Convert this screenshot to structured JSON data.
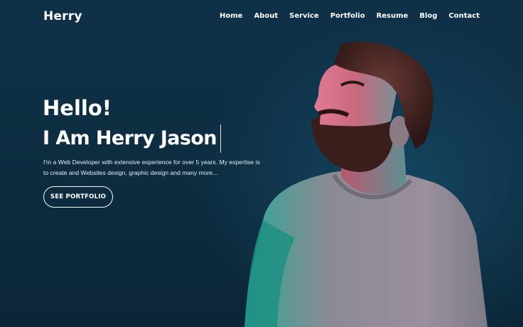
{
  "brand": {
    "logo_text": "Herry"
  },
  "nav": {
    "items": [
      {
        "label": "Home"
      },
      {
        "label": "About"
      },
      {
        "label": "Service"
      },
      {
        "label": "Portfolio"
      },
      {
        "label": "Resume"
      },
      {
        "label": "Blog"
      },
      {
        "label": "Contact"
      }
    ]
  },
  "hero": {
    "greeting": "Hello!",
    "name_line": "I Am Herry Jason",
    "description": "I'm a Web Developer with extensive experience for over 5 years. My expertise is to create and Websites design, graphic design and many more...",
    "cta_label": "SEE PORTFOLIO",
    "image_subject": "bearded-man-portrait"
  },
  "colors": {
    "background": "#0e2f44",
    "text": "#ffffff",
    "shirt": "#8c8a93",
    "hair_beard": "#3b1f1c",
    "teal_light": "#1fb6a4",
    "pink_light": "#e0708a"
  }
}
